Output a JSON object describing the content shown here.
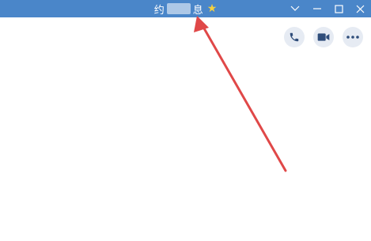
{
  "window": {
    "title_prefix": "约",
    "title_suffix": "息",
    "title_star": "★",
    "accent": "#4a86c9"
  },
  "titlebar_controls": [
    {
      "name": "dropdown",
      "icon": "chevron-down-icon"
    },
    {
      "name": "minimize",
      "icon": "minimize-icon"
    },
    {
      "name": "maximize",
      "icon": "maximize-icon"
    },
    {
      "name": "close",
      "icon": "close-icon"
    }
  ],
  "chat_actions": [
    {
      "name": "voice-call",
      "icon": "phone-icon"
    },
    {
      "name": "video-call",
      "icon": "video-camera-icon"
    },
    {
      "name": "more",
      "icon": "more-icon"
    }
  ],
  "annotation": {
    "type": "arrow",
    "color": "#e04848"
  }
}
